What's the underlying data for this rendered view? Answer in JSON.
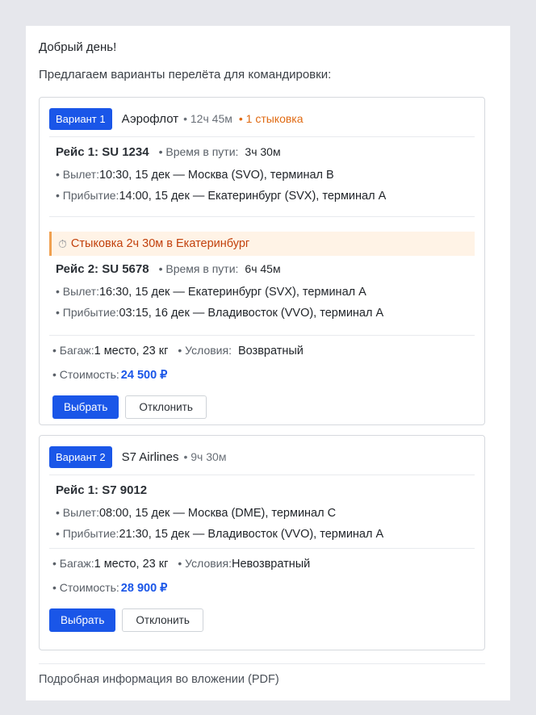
{
  "greeting": "Добрый день!",
  "intro": "Предлагаем варианты перелёта для командировки:",
  "options": [
    {
      "badge": "Вариант 1",
      "airline": "Аэрофлот",
      "total": "• 12ч 45м",
      "transfers": "• 1 стыковка",
      "flights": [
        {
          "number": "Рейс 1: SU 1234",
          "duration_label": "• Время в пути:",
          "duration": "3ч 30м",
          "departure_label": "• Вылет:",
          "departure": "10:30, 15 дек — Москва (SVO), терминал B",
          "arrival_label": "• Прибытие:",
          "arrival": "14:00, 15 дек — Екатеринбург (SVX), терминал A"
        },
        {
          "number": "Рейс 2: SU 5678",
          "duration_label": "• Время в пути:",
          "duration": "6ч 45м",
          "departure_label": "• Вылет:",
          "departure": "16:30, 15 дек — Екатеринбург (SVX), терминал A",
          "arrival_label": "• Прибытие:",
          "arrival": "03:15, 16 дек — Владивосток (VVO), терминал A"
        }
      ],
      "connection": "Стыковка 2ч 30м в Екатеринбург",
      "baggage_label": "• Багаж:",
      "baggage": "1 место, 23 кг",
      "conditions_label": "• Условия:",
      "conditions": "Возвратный",
      "price_label": "• Стоимость:",
      "price": "24 500 ₽",
      "select": "Выбрать",
      "decline": "Отклонить"
    },
    {
      "badge": "Вариант 2",
      "airline": "S7 Airlines",
      "total": "• 9ч 30м",
      "flights": [
        {
          "number": "Рейс 1: S7 9012",
          "departure_label": "• Вылет:",
          "departure": "08:00, 15 дек — Москва (DME), терминал C",
          "arrival_label": "• Прибытие:",
          "arrival": "21:30, 15 дек — Владивосток (VVO), терминал A"
        }
      ],
      "baggage_label": "• Багаж:",
      "baggage": "1 место, 23 кг",
      "conditions_label": "• Условия:",
      "conditions": "Невозвратный",
      "price_label": "• Стоимость:",
      "price": "28 900 ₽",
      "select": "Выбрать",
      "decline": "Отклонить"
    }
  ],
  "footer": "Подробная информация во вложении (PDF)",
  "colors": {
    "accent": "#1a56e8",
    "warning": "#e06a12",
    "connection_bg": "#fff3e6"
  },
  "icons": {
    "connection": "stopwatch-icon"
  }
}
